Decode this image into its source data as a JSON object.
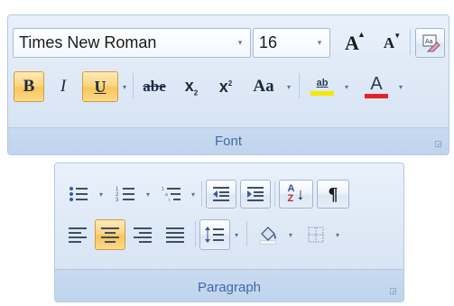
{
  "font_group": {
    "label": "Font",
    "font_name": "Times New Roman",
    "font_size": "16",
    "grow_font_label": "A",
    "shrink_font_label": "A",
    "bold_label": "B",
    "italic_label": "I",
    "underline_label": "U",
    "strikethrough_label": "abe",
    "subscript_label": "x",
    "subscript_suffix": "2",
    "superscript_label": "x",
    "superscript_suffix": "2",
    "change_case_label": "Aa",
    "highlight_label": "ab",
    "font_color_label": "A",
    "highlight_color": "#f5e800",
    "font_color": "#e8202a",
    "active_color": "#f9c65a",
    "dropdown_arrow": "▾"
  },
  "paragraph_group": {
    "label": "Paragraph",
    "sort_top": "A",
    "sort_bottom": "Z",
    "pilcrow": "¶",
    "dropdown_arrow": "▾"
  },
  "icons": [
    "clear-formatting-icon",
    "bullets-icon",
    "numbering-icon",
    "multilevel-list-icon",
    "decrease-indent-icon",
    "increase-indent-icon",
    "sort-icon",
    "show-formatting-marks-icon",
    "align-left-icon",
    "center-icon",
    "align-right-icon",
    "justify-icon",
    "line-spacing-icon",
    "shading-icon",
    "borders-icon",
    "dialog-launcher-icon"
  ]
}
